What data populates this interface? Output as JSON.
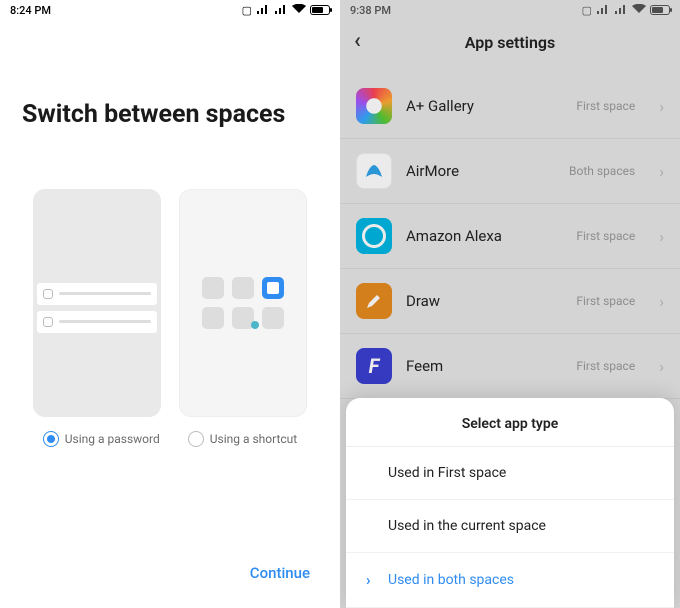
{
  "left": {
    "status_time": "8:24 PM",
    "title": "Switch between spaces",
    "option_password": "Using a password",
    "option_shortcut": "Using a shortcut",
    "selected_option": "password",
    "continue_label": "Continue"
  },
  "right": {
    "status_time": "9:38 PM",
    "header_title": "App settings",
    "apps": [
      {
        "name": "A+ Gallery",
        "space": "First space",
        "icon": "gallery"
      },
      {
        "name": "AirMore",
        "space": "Both spaces",
        "icon": "airmore"
      },
      {
        "name": "Amazon Alexa",
        "space": "First space",
        "icon": "alexa"
      },
      {
        "name": "Draw",
        "space": "First space",
        "icon": "draw"
      },
      {
        "name": "Feem",
        "space": "First space",
        "icon": "feem"
      }
    ],
    "sheet": {
      "title": "Select app type",
      "options": [
        "Used in First space",
        "Used in the current space",
        "Used in both spaces"
      ],
      "selected_index": 2
    }
  },
  "colors": {
    "accent": "#2f8cf0"
  }
}
